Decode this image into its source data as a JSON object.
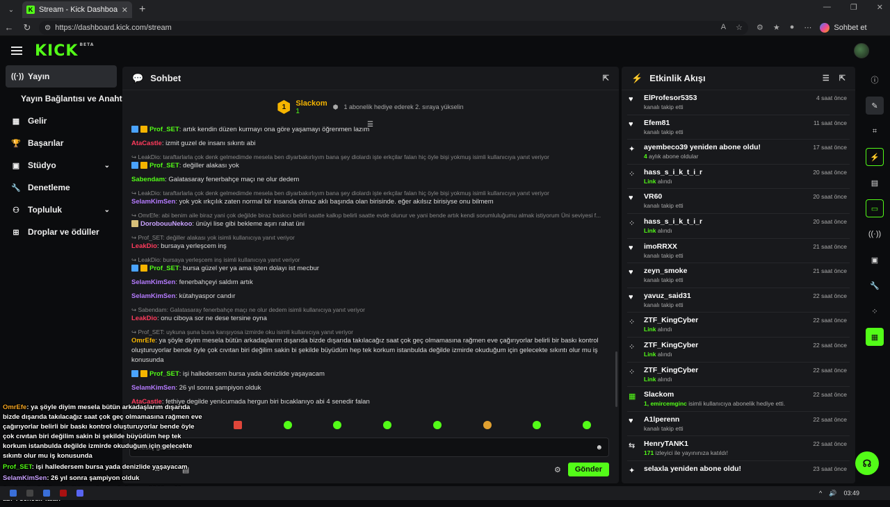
{
  "browser": {
    "tab_title": "Stream - Kick Dashboard",
    "tab_favicon": "K",
    "url": "https://dashboard.kick.com/stream",
    "copilot_label": "Sohbet et"
  },
  "header": {
    "logo": "KICK",
    "logo_tag": "BETA"
  },
  "sidebar": {
    "items": [
      {
        "label": "Yayın",
        "icon": "broadcast-icon"
      },
      {
        "label": "Yayın Bağlantısı ve Anahtarı",
        "icon": ""
      },
      {
        "label": "Gelir",
        "icon": "revenue-icon"
      },
      {
        "label": "Başarılar",
        "icon": "trophy-icon"
      },
      {
        "label": "Stüdyo",
        "icon": "studio-icon"
      },
      {
        "label": "Denetleme",
        "icon": "wrench-icon"
      },
      {
        "label": "Topluluk",
        "icon": "community-icon"
      },
      {
        "label": "Droplar ve ödüller",
        "icon": "gift-icon"
      }
    ]
  },
  "chat": {
    "title": "Sohbet",
    "pinned": {
      "level": "1",
      "name": "Slackom",
      "count": "1",
      "text": "1 abonelik hediye ederek 2. sıraya yükselin"
    },
    "messages": [
      {
        "reply": "",
        "user": "Prof_SET",
        "color": "c-green",
        "badges": "blue-gift",
        "text": ": artık kendin düzen kurmayı ona göre yaşamayı öğrenmen lazım"
      },
      {
        "reply": "",
        "user": "AtaCastle",
        "color": "c-red",
        "badges": "",
        "text": ": izmit guzel de insanı sıkıntı abi"
      },
      {
        "reply": "↪ LeakDio: taraftarlarla çok denk gelmedimde mesela ben diyarbakırlıyım bana şey diolardı işte erkçilar falan hiç öyle bişi yokmuş isimli kullanıcıya yanıt veriyor",
        "user": "Prof_SET",
        "color": "c-green",
        "badges": "blue-gift",
        "text": ": değiller alakası yok"
      },
      {
        "reply": "",
        "user": "Sabendam",
        "color": "c-green",
        "badges": "",
        "text": ": Galatasaray fenerbahçe maçı ne olur dedem"
      },
      {
        "reply": "↪ LeakDio: taraftarlarla çok denk gelmedimde mesela ben diyarbakırlıyım bana şey diolardı işte erkçilar falan hiç öyle bişi yokmuş isimli kullanıcıya yanıt veriyor",
        "user": "SelamKimSen",
        "color": "c-purple",
        "badges": "",
        "text": ": yok yok ırkçılık zaten normal bir insanda olmaz aklı başında olan birisinde. eğer akılsız birisiyse onu bilmem"
      },
      {
        "reply": "↪ OmrEfe: abi benim aile biraz yani çok değilde biraz baskıcı belirli saatte kalkıp belirli saatte evde olunur ve yani bende artık kendi sorumluluğumu almak istiyorum Üni seviyesi f...",
        "user": "DorobouuNekoo",
        "color": "c-lilac",
        "badges": "x",
        "text": ": ünüyi lise gibi bekleme aşırı rahat üni"
      },
      {
        "reply": "↪ Prof_SET: değiller alakası yok isimli kullanıcıya yanıt veriyor",
        "user": "LeakDio",
        "color": "c-red",
        "badges": "",
        "text": ": bursaya yerleşcem inş"
      },
      {
        "reply": "↪ LeakDio: bursaya yerleşcem inş isimli kullanıcıya yanıt veriyor",
        "user": "Prof_SET",
        "color": "c-green",
        "badges": "blue-gift",
        "text": ": bursa güzel yer ya ama işten dolayı ist mecbur"
      },
      {
        "reply": "",
        "user": "SelamKimSen",
        "color": "c-purple",
        "badges": "",
        "text": ": fenerbahçeyi saldım artık"
      },
      {
        "reply": "",
        "user": "SelamKimSen",
        "color": "c-purple",
        "badges": "",
        "text": ": kütahyaspor candır"
      },
      {
        "reply": "↪ Sabendam: Galatasaray fenerbahçe maçı ne olur dedem isimli kullanıcıya yanıt veriyor",
        "user": "LeakDio",
        "color": "c-red",
        "badges": "",
        "text": ": onu ciboya sor ne dese tersine oyna"
      },
      {
        "reply": "↪ Prof_SET: uykuna şuna buna karışıyosa izmirde oku isimli kullanıcıya yanıt veriyor",
        "user": "OmrEfe",
        "color": "c-orange",
        "badges": "",
        "text": ": ya şöyle diyim mesela bütün arkadaşlarım dışarıda bizde dışarıda takılacağız saat çok geç olmamasına rağmen eve çağırıyorlar belirli bir baskı kontrol oluşturuyorlar bende öyle çok cıvıtan biri değilim sakin bi şekilde büyüdüm hep tek korkum istanbulda değilde izmirde okuduğum için gelecekte sıkıntı olur mu iş konusunda"
      },
      {
        "reply": "",
        "user": "Prof_SET",
        "color": "c-green",
        "badges": "blue-gift",
        "text": ": işi halledersem bursa yada denizlide yaşayacam"
      },
      {
        "reply": "",
        "user": "SelamKimSen",
        "color": "c-purple",
        "badges": "",
        "text": ": 26 yıl sonra şampiyon olduk"
      },
      {
        "reply": "",
        "user": "AtaCastle",
        "color": "c-red",
        "badges": "",
        "text": ": fethiye degilde yenicumada hergun biri bıcaklanıyo abi 4 senedir falan"
      }
    ],
    "input_placeholder": "Mesaj gönderin",
    "send_label": "Gönder"
  },
  "overlay": [
    {
      "user": "OmrEfe",
      "color": "o-orange",
      "text": ": ya şöyle diyim mesela bütün arkadaşlarım dışarıda bizde dışarıda takılacağız saat çok geç olmamasına rağmen eve çağırıyorlar belirli bir baskı kontrol oluşturuyorlar bende öyle çok cıvıtan biri değilim sakin bi şekilde büyüdüm hep tek korkum istanbulda değilde izmirde okuduğum için gelecekte sıkıntı olur mu iş konusunda"
    },
    {
      "user": "Prof_SET",
      "color": "o-green",
      "text": ": işi halledersem bursa yada denizlide yaşayacam"
    },
    {
      "user": "SelamKimSen",
      "color": "o-purple",
      "text": ": 26 yıl sonra şampiyon olduk"
    },
    {
      "user": "AtaCastle",
      "color": "o-red",
      "text": ": fethiye degilde yenicumada hergun biri bıcaklanıyo abi 4 senedir falan"
    }
  ],
  "activity": {
    "title": "Etkinlik Akışı",
    "items": [
      {
        "icon": "heart-icon",
        "name": "ElProfesor5353",
        "sub_hl": "",
        "sub": "kanalı takip etti",
        "time": "4 saat önce"
      },
      {
        "icon": "heart-icon",
        "name": "Efem81",
        "sub_hl": "",
        "sub": "kanalı takip etti",
        "time": "11 saat önce"
      },
      {
        "icon": "sparkle-icon",
        "name": "ayembeco39 yeniden abone oldu!",
        "sub_hl": "4",
        "sub": " aylık abone oldular",
        "time": "17 saat önce"
      },
      {
        "icon": "dots-icon",
        "name": "hass_s_i_k_t_i_r",
        "sub_hl": "Link",
        "sub": " alındı",
        "time": "20 saat önce"
      },
      {
        "icon": "heart-icon",
        "name": "VR60",
        "sub_hl": "",
        "sub": "kanalı takip etti",
        "time": "20 saat önce"
      },
      {
        "icon": "dots-icon",
        "name": "hass_s_i_k_t_i_r",
        "sub_hl": "Link",
        "sub": " alındı",
        "time": "20 saat önce"
      },
      {
        "icon": "heart-icon",
        "name": "imoRRXX",
        "sub_hl": "",
        "sub": "kanalı takip etti",
        "time": "21 saat önce"
      },
      {
        "icon": "heart-icon",
        "name": "zeyn_smoke",
        "sub_hl": "",
        "sub": "kanalı takip etti",
        "time": "21 saat önce"
      },
      {
        "icon": "heart-icon",
        "name": "yavuz_said31",
        "sub_hl": "",
        "sub": "kanalı takip etti",
        "time": "22 saat önce"
      },
      {
        "icon": "dots-icon",
        "name": "ZTF_KingCyber",
        "sub_hl": "Link",
        "sub": " alındı",
        "time": "22 saat önce"
      },
      {
        "icon": "dots-icon",
        "name": "ZTF_KingCyber",
        "sub_hl": "Link",
        "sub": " alındı",
        "time": "22 saat önce"
      },
      {
        "icon": "dots-icon",
        "name": "ZTF_KingCyber",
        "sub_hl": "Link",
        "sub": " alındı",
        "time": "22 saat önce"
      },
      {
        "icon": "gift-icon",
        "name": "Slackom",
        "sub_hl": "1, emircemginc",
        "sub": " isimli kullanıcıya abonelik hediye etti.",
        "time": "22 saat önce"
      },
      {
        "icon": "heart-icon",
        "name": "A1lperenn",
        "sub_hl": "",
        "sub": "kanalı takip etti",
        "time": "22 saat önce"
      },
      {
        "icon": "raid-icon",
        "name": "HenryTANK1",
        "sub_hl": "171",
        "sub": " izleyici ile yayınınıza katıldı!",
        "time": "22 saat önce"
      },
      {
        "icon": "sparkle-icon",
        "name": "selaxla yeniden abone oldu!",
        "sub_hl": "",
        "sub": "",
        "time": "23 saat önce"
      }
    ]
  },
  "taskbar": {
    "time": "03:49"
  },
  "icons": {
    "info": "ⓘ",
    "pencil": "✎",
    "bolt": "⚡",
    "chat": "💬",
    "wrench": "🔧"
  },
  "colors": {
    "accent": "#53fc18",
    "panel": "#18191c",
    "bg": "#0b0c0e"
  }
}
